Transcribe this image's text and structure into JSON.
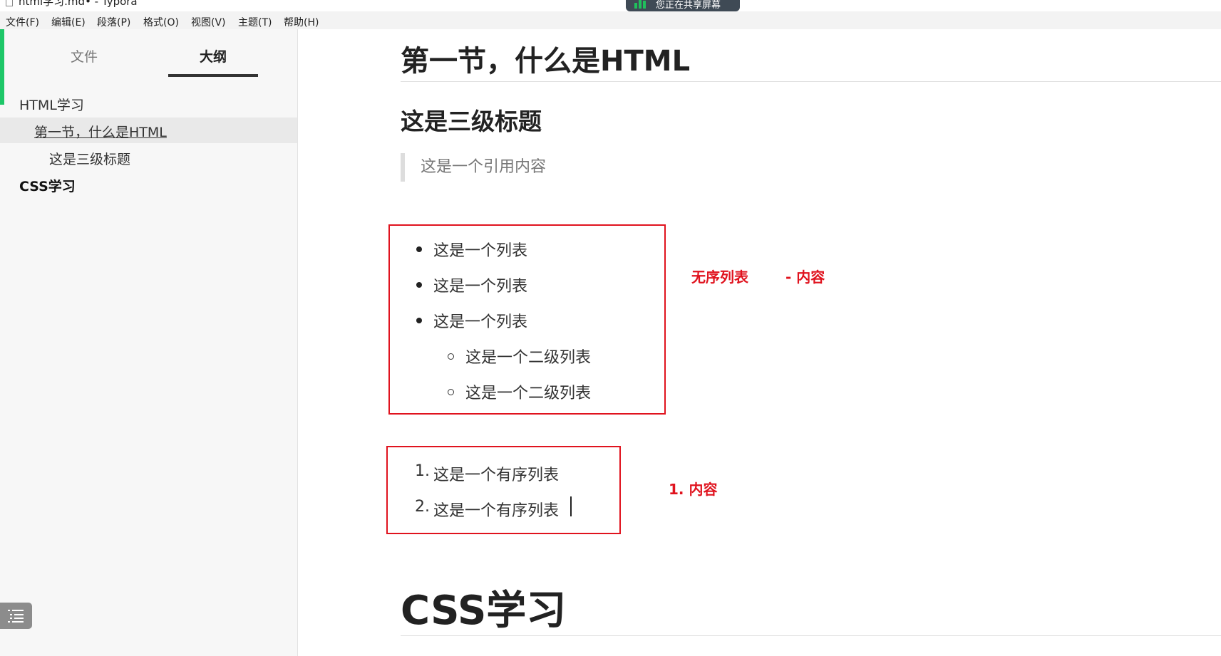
{
  "window": {
    "title": "html学习.md• - Typora",
    "share_notice": "您正在共享屏幕"
  },
  "menu": [
    "文件(F)",
    "编辑(E)",
    "段落(P)",
    "格式(O)",
    "视图(V)",
    "主题(T)",
    "帮助(H)"
  ],
  "sidebar": {
    "tabs": [
      "文件",
      "大纲"
    ],
    "active_tab": "大纲",
    "outline": [
      {
        "label": "HTML学习",
        "level": 1
      },
      {
        "label": "第一节，什么是HTML",
        "level": 2,
        "active": true
      },
      {
        "label": "这是三级标题",
        "level": 3
      },
      {
        "label": "CSS学习",
        "level": 1
      }
    ]
  },
  "document": {
    "h2": "第一节，什么是HTML",
    "h3": "这是三级标题",
    "blockquote": "这是一个引用内容",
    "unordered_list": [
      "这是一个列表",
      "这是一个列表",
      "这是一个列表"
    ],
    "nested_list": [
      "这是一个二级列表",
      "这是一个二级列表"
    ],
    "ordered_list": [
      {
        "marker": "1.",
        "text": "这是一个有序列表"
      },
      {
        "marker": "2.",
        "text": "这是一个有序列表"
      }
    ],
    "h1": "CSS学习"
  },
  "annotations": {
    "unordered": "无序列表",
    "unordered_syntax": "- 内容",
    "ordered": "1. 内容",
    "color": "#e0131e"
  },
  "colors": {
    "accent_green": "#1ec768",
    "annotation_red": "#e0131e"
  }
}
